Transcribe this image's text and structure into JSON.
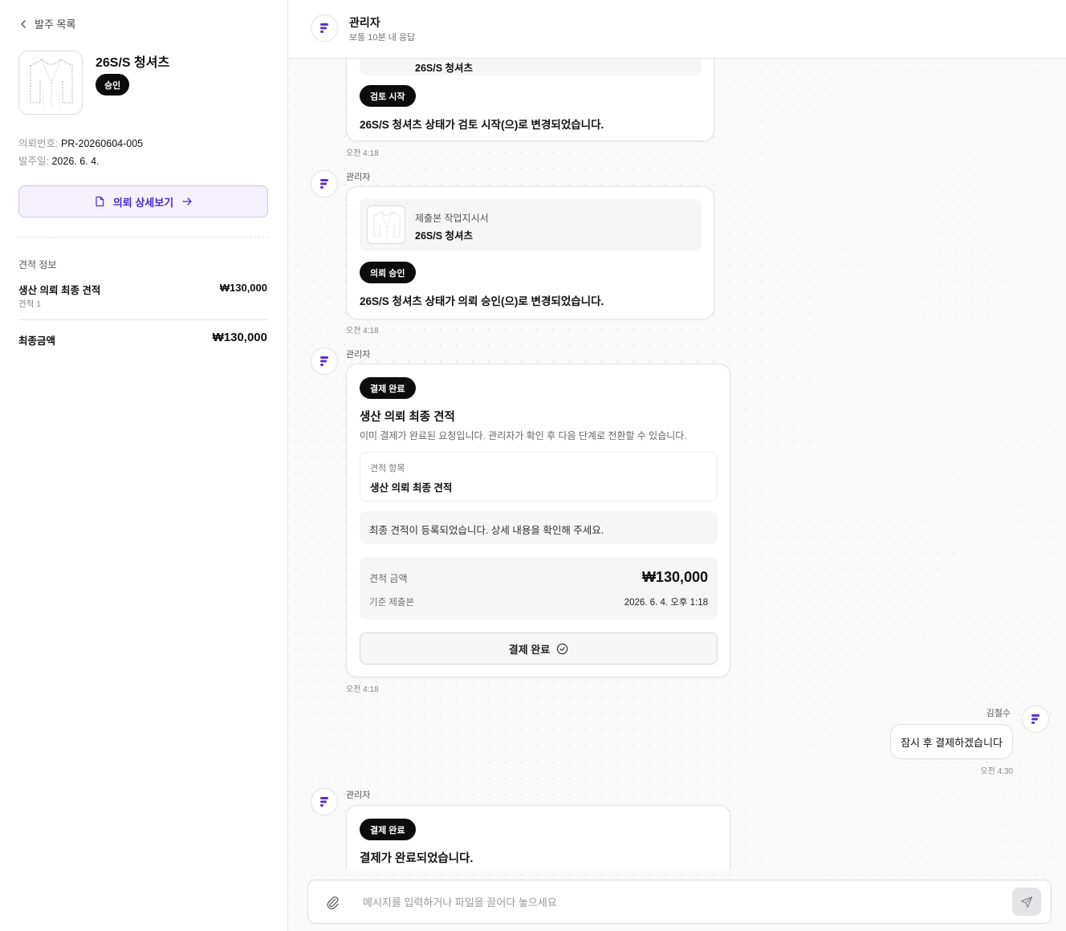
{
  "sidebar": {
    "back_label": "발주 목록",
    "product_name": "26S/S 청셔츠",
    "status": "승인",
    "request_no_label": "의뢰번호:",
    "request_no": "PR-20260604-005",
    "order_date_label": "발주일:",
    "order_date": "2026. 6. 4.",
    "detail_button_label": "의뢰 상세보기",
    "quote_section_label": "견적 정보",
    "quote_title": "생산 의뢰 최종 견적",
    "quote_sub": "견적 1",
    "quote_amount": "₩130,000",
    "final_label": "최종금액",
    "final_amount": "₩130,000"
  },
  "header": {
    "name": "관리자",
    "sub": "보통 10분 내 응답"
  },
  "messages": {
    "m1": {
      "partial_file_name": "26S/S 청셔츠",
      "badge": "검토 시작",
      "text": "26S/S 청셔츠 상태가 검토 시작(으)로 변경되었습니다.",
      "time": "오전 4:18"
    },
    "m2": {
      "sender": "관리자",
      "file_label": "제출본 작업지시서",
      "file_name": "26S/S 청셔츠",
      "badge": "의뢰 승인",
      "text": "26S/S 청셔츠 상태가 의뢰 승인(으)로 변경되었습니다.",
      "time": "오전 4:18"
    },
    "m3": {
      "sender": "관리자",
      "badge": "결제 완료",
      "title": "생산 의뢰 최종 견적",
      "desc": "이미 결제가 완료된 요청입니다. 관리자가 확인 후 다음 단계로 전환할 수 있습니다.",
      "item_label": "견적 항목",
      "item_value": "생산 의뢰 최종 견적",
      "notice": "최종 견적이 등록되었습니다. 상세 내용을 확인해 주세요.",
      "amount_label": "견적 금액",
      "amount": "₩130,000",
      "basis_label": "기준 제출본",
      "basis_value": "2026. 6. 4. 오후 1:18",
      "button_label": "결제 완료",
      "time": "오전 4:18"
    },
    "m4": {
      "sender": "김철수",
      "text": "잠시 후 결제하겠습니다",
      "time": "오전 4:30"
    },
    "m5": {
      "sender": "관리자",
      "badge": "결제 완료",
      "text": "결제가 완료되었습니다."
    }
  },
  "composer": {
    "placeholder": "메시지를 입력하거나 파일을 끌어다 놓으세요"
  },
  "colors": {
    "brand": "#5b2fd6",
    "dark_badge": "#0c0c0c",
    "detail_button_text": "#4b2bd0",
    "detail_button_bg": "#f5f2fe"
  }
}
